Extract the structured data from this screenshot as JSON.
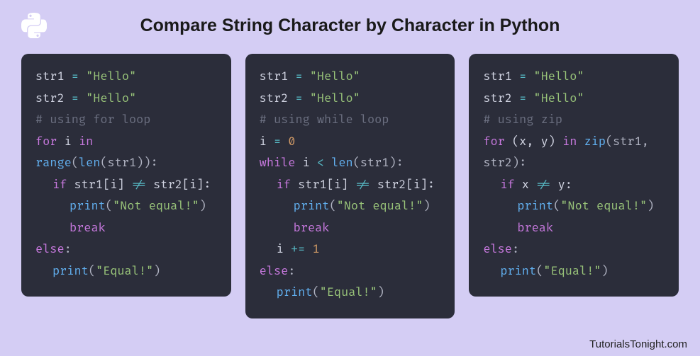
{
  "title": "Compare String Character by Character in Python",
  "footer": "TutorialsTonight.com",
  "code1": {
    "l1a": "str1 ",
    "l1b": "=",
    "l1c": " \"Hello\"",
    "l2a": "str2 ",
    "l2b": "=",
    "l2c": " \"Hello\"",
    "l3": "# using for loop",
    "l4a": "for",
    "l4b": " i ",
    "l4c": "in",
    "l4d": " range",
    "l4e": "(",
    "l4f": "len",
    "l4g": "(str1)):",
    "l5a": "if",
    "l5b": " str1[i] ",
    "l5c": "!=",
    "l5d": " str2[i]:",
    "l6a": "print",
    "l6b": "(",
    "l6c": "\"Not equal!\"",
    "l6d": ")",
    "l7": "break",
    "l8a": "else",
    "l8b": ":",
    "l9a": "print",
    "l9b": "(",
    "l9c": "\"Equal!\"",
    "l9d": ")"
  },
  "code2": {
    "l1a": "str1 ",
    "l1b": "=",
    "l1c": " \"Hello\"",
    "l2a": "str2 ",
    "l2b": "=",
    "l2c": " \"Hello\"",
    "l3": "# using while loop",
    "l4a": "i ",
    "l4b": "=",
    "l4c": " 0",
    "l5a": "while",
    "l5b": " i ",
    "l5c": "<",
    "l5d": " len",
    "l5e": "(str1):",
    "l6a": "if",
    "l6b": " str1[i] ",
    "l6c": "!=",
    "l6d": " str2[i]:",
    "l7a": "print",
    "l7b": "(",
    "l7c": "\"Not equal!\"",
    "l7d": ")",
    "l8": "break",
    "l9a": "i ",
    "l9b": "+=",
    "l9c": " 1",
    "l10a": "else",
    "l10b": ":",
    "l11a": "print",
    "l11b": "(",
    "l11c": "\"Equal!\"",
    "l11d": ")"
  },
  "code3": {
    "l1a": "str1 ",
    "l1b": "=",
    "l1c": " \"Hello\"",
    "l2a": "str2 ",
    "l2b": "=",
    "l2c": " \"Hello\"",
    "l3": "# using zip",
    "l4a": "for",
    "l4b": " (x, y) ",
    "l4c": "in",
    "l4d": " zip",
    "l4e": "(str1,",
    "l5": "str2):",
    "l6a": "if",
    "l6b": " x ",
    "l6c": "!=",
    "l6d": " y:",
    "l7a": "print",
    "l7b": "(",
    "l7c": "\"Not equal!\"",
    "l7d": ")",
    "l8": "break",
    "l9a": "else",
    "l9b": ":",
    "l10a": "print",
    "l10b": "(",
    "l10c": "\"Equal!\"",
    "l10d": ")"
  }
}
